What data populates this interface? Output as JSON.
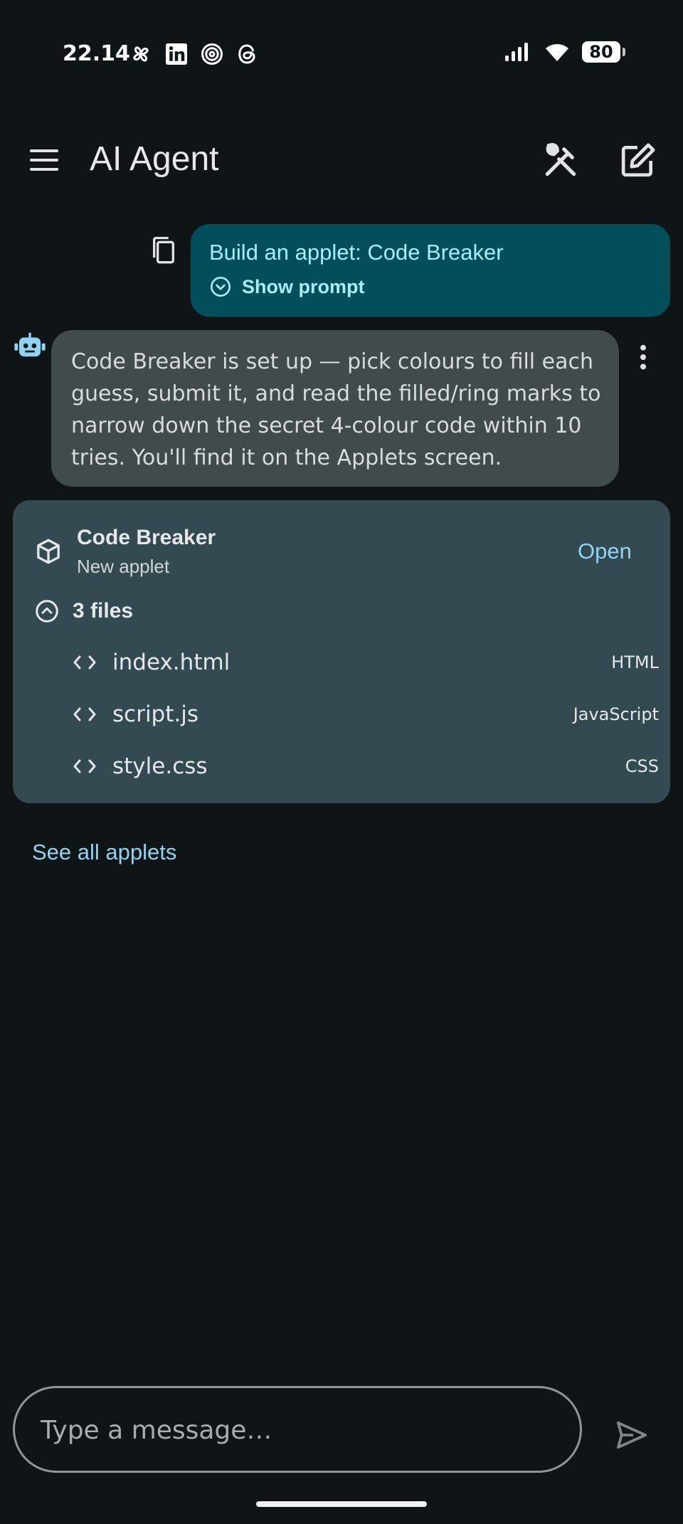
{
  "status_bar": {
    "time": "22.14",
    "battery": "80",
    "left_icons": [
      "pinwheel-icon",
      "linkedin-icon",
      "target-icon",
      "threads-icon"
    ],
    "right_icons": [
      "signal-icon",
      "wifi-icon",
      "battery-icon"
    ]
  },
  "app_bar": {
    "title": "AI Agent",
    "icons": [
      "menu-icon",
      "tools-icon",
      "edit-icon"
    ]
  },
  "conversation": {
    "user_message": {
      "text": "Build an applet: Code Breaker",
      "show_prompt_label": "Show prompt"
    },
    "bot_message": {
      "text": "Code Breaker is set up — pick colours to fill each guess, submit it, and read the filled/ring marks to narrow down the secret 4-colour code within 10 tries. You'll find it on the Applets screen."
    },
    "applet_card": {
      "name": "Code Breaker",
      "subtitle": "New applet",
      "open_label": "Open",
      "files_label": "3 files",
      "files": [
        {
          "name": "index.html",
          "type": "HTML"
        },
        {
          "name": "script.js",
          "type": "JavaScript"
        },
        {
          "name": "style.css",
          "type": "CSS"
        }
      ]
    },
    "see_all_label": "See all applets"
  },
  "composer": {
    "placeholder": "Type a message…"
  },
  "colors": {
    "background": "#0f1417",
    "user_bubble": "#024f5b",
    "bot_bubble": "#414a4d",
    "card": "#344a52",
    "accent": "#8fd4f0"
  }
}
